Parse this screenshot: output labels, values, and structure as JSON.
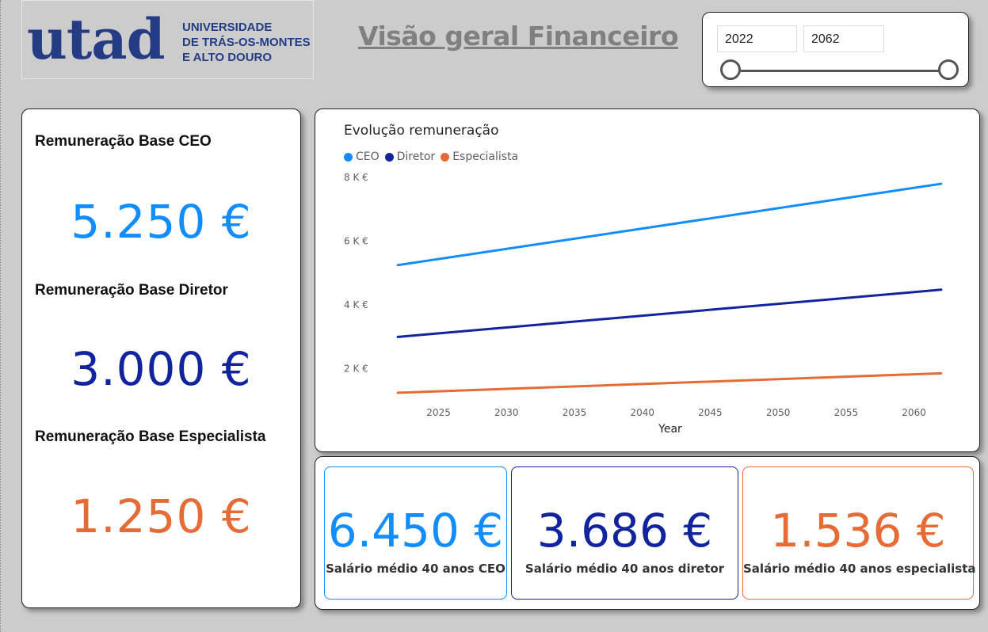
{
  "logo": {
    "mark": "utad",
    "lines": [
      "UNIVERSIDADE",
      "DE TRÁS-OS-MONTES",
      "E ALTO DOURO"
    ]
  },
  "title": "Visão geral Financeiro",
  "slicer": {
    "from": "2022",
    "to": "2062"
  },
  "kpis": [
    {
      "label": "Remuneração Base CEO",
      "value": "5.250 €",
      "color": "#118dff"
    },
    {
      "label": "Remuneração Base Diretor",
      "value": "3.000 €",
      "color": "#12239e"
    },
    {
      "label": "Remuneração Base Especialista",
      "value": "1.250 €",
      "color": "#e66c37"
    }
  ],
  "chart": {
    "title": "Evolução remuneração",
    "legend": [
      {
        "name": "CEO",
        "color": "#118dff"
      },
      {
        "name": "Diretor",
        "color": "#12239e"
      },
      {
        "name": "Especialista",
        "color": "#e66c37"
      }
    ]
  },
  "chart_data": {
    "type": "line",
    "title": "Evolução remuneração",
    "xlabel": "Year",
    "ylabel": "",
    "x": [
      2022,
      2062
    ],
    "xticks": [
      2025,
      2030,
      2035,
      2040,
      2045,
      2050,
      2055,
      2060
    ],
    "yticks": [
      2000,
      4000,
      6000,
      8000
    ],
    "ytick_labels": [
      "2 K €",
      "4 K €",
      "6 K €",
      "8 K €"
    ],
    "ylim": [
      1000,
      8000
    ],
    "xlim": [
      2021,
      2063
    ],
    "grid": false,
    "legend_position": "top-left",
    "series": [
      {
        "name": "CEO",
        "color": "#118dff",
        "values": [
          5250,
          7800
        ]
      },
      {
        "name": "Diretor",
        "color": "#12239e",
        "values": [
          3000,
          4480
        ]
      },
      {
        "name": "Especialista",
        "color": "#e66c37",
        "values": [
          1250,
          1860
        ]
      }
    ]
  },
  "averages": [
    {
      "value": "6.450 €",
      "label": "Salário médio 40 anos CEO",
      "color": "#118dff"
    },
    {
      "value": "3.686 €",
      "label": "Salário médio 40 anos diretor",
      "color": "#12239e"
    },
    {
      "value": "1.536 €",
      "label": "Salário médio 40 anos especialista",
      "color": "#e66c37"
    }
  ]
}
